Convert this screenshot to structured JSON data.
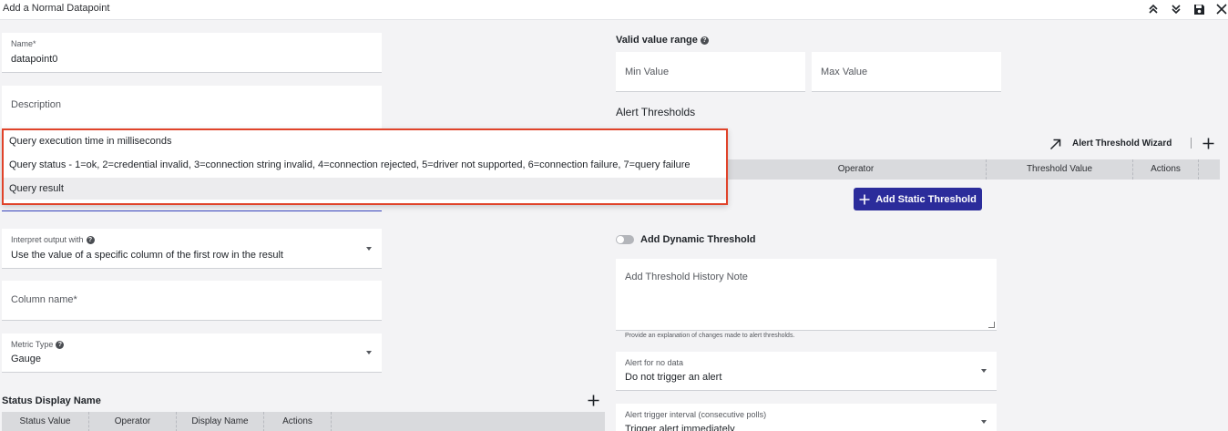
{
  "window": {
    "title": "Add a Normal Datapoint"
  },
  "form": {
    "name": {
      "label": "Name*",
      "value": "datapoint0"
    },
    "description": {
      "placeholder": "Description"
    },
    "description_options": [
      "Query execution time in milliseconds",
      "Query status - 1=ok, 2=credential invalid, 3=connection string invalid, 4=connection rejected, 5=driver not supported, 6=connection failure, 7=query failure",
      "Query result"
    ],
    "interpret": {
      "label": "Interpret output with",
      "value": "Use the value of a specific column of the first row in the result"
    },
    "column_name": {
      "placeholder": "Column name*"
    },
    "metric_type": {
      "label": "Metric Type",
      "value": "Gauge"
    },
    "status_display": {
      "title": "Status Display Name",
      "columns": [
        "Status Value",
        "Operator",
        "Display Name",
        "Actions"
      ]
    }
  },
  "right": {
    "valid_range": {
      "title": "Valid value range",
      "min_placeholder": "Min Value",
      "max_placeholder": "Max Value"
    },
    "alert_thresholds": {
      "title": "Alert Thresholds",
      "wizard_label": "Alert Threshold Wizard",
      "columns": [
        "Operator",
        "Threshold Value",
        "Actions"
      ],
      "add_static_label": "Add Static Threshold"
    },
    "dynamic_threshold": {
      "label": "Add Dynamic Threshold"
    },
    "history_note": {
      "placeholder": "Add Threshold History Note",
      "hint": "Provide an explanation of changes made to alert thresholds."
    },
    "alert_no_data": {
      "label": "Alert for no data",
      "value": "Do not trigger an alert"
    },
    "alert_trigger": {
      "label": "Alert trigger interval (consecutive polls)",
      "value": "Trigger alert immediately"
    }
  },
  "colors": {
    "accent": "#2b2c9b",
    "highlight_border": "#e0432a",
    "background": "#f3f3f5"
  }
}
